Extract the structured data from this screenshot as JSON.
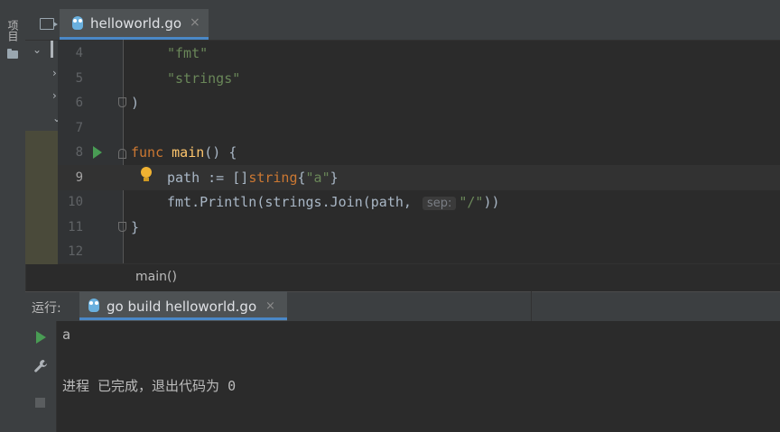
{
  "project_tool_label": "项目",
  "editor": {
    "tab": {
      "label": "helloworld.go",
      "close": "×"
    },
    "lines": [
      {
        "num": "4",
        "text": "\"fmt\""
      },
      {
        "num": "5",
        "text": "\"strings\""
      },
      {
        "num": "6",
        "text": ")"
      },
      {
        "num": "7",
        "text": ""
      },
      {
        "num": "8",
        "text": "func main() {"
      },
      {
        "num": "9",
        "text": "path := []string{\"a\"}"
      },
      {
        "num": "10",
        "text": "fmt.Println(strings.Join(path, sep: \"/\"))"
      },
      {
        "num": "11",
        "text": "}"
      },
      {
        "num": "12",
        "text": ""
      }
    ],
    "tokens": {
      "l4_str": "\"fmt\"",
      "l5_str": "\"strings\"",
      "l6_paren": ")",
      "l8_kw": "func",
      "l8_fn": "main",
      "l8_rest": "() {",
      "l9_var": "path := []",
      "l9_kw": "string",
      "l9_open": "{",
      "l9_str": "\"a\"",
      "l9_close": "}",
      "l10_pre": "fmt.Println(strings.Join(path, ",
      "l10_hint": "sep:",
      "l10_str": "\"/\"",
      "l10_post": "))",
      "l11_brace": "}"
    },
    "breadcrumb": "main()"
  },
  "run": {
    "label": "运行:",
    "tab": {
      "label": "go build helloworld.go",
      "close": "×"
    },
    "output": [
      "a",
      "",
      "进程 已完成，退出代码为 0"
    ]
  }
}
